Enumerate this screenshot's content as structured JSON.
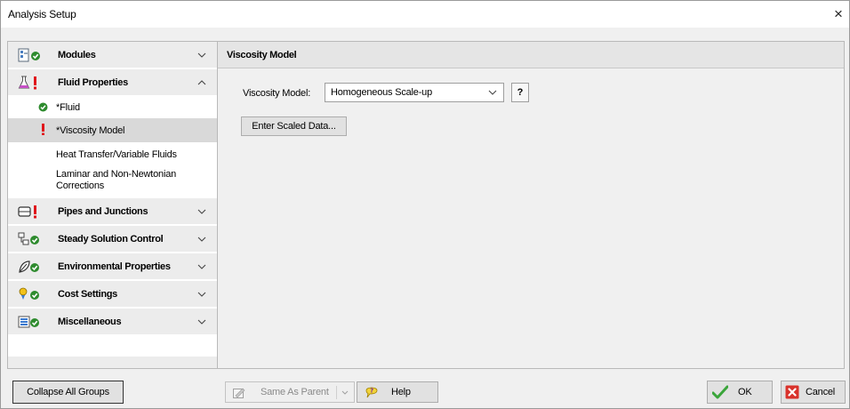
{
  "window": {
    "title": "Analysis Setup",
    "close_glyph": "×"
  },
  "sidebar": {
    "groups": [
      {
        "label": "Modules",
        "icon": "modules-icon",
        "status": "ok",
        "chevron": "down"
      },
      {
        "label": "Fluid Properties",
        "icon": "flask-icon",
        "status": "error",
        "chevron": "up",
        "items": [
          {
            "label": "*Fluid",
            "status": "ok"
          },
          {
            "label": "*Viscosity Model",
            "status": "error",
            "selected": true
          },
          {
            "label": "Heat Transfer/Variable Fluids",
            "status": "none"
          },
          {
            "label": "Laminar and Non-Newtonian Corrections",
            "status": "none"
          }
        ]
      },
      {
        "label": "Pipes and Junctions",
        "icon": "pipe-icon",
        "status": "error",
        "chevron": "down"
      },
      {
        "label": "Steady Solution Control",
        "icon": "solution-control-icon",
        "status": "ok",
        "chevron": "down"
      },
      {
        "label": "Environmental Properties",
        "icon": "environment-icon",
        "status": "ok",
        "chevron": "down"
      },
      {
        "label": "Cost Settings",
        "icon": "cost-icon",
        "status": "ok",
        "chevron": "down"
      },
      {
        "label": "Miscellaneous",
        "icon": "misc-icon",
        "status": "ok",
        "chevron": "down"
      }
    ]
  },
  "content": {
    "header": "Viscosity Model",
    "viscosity_label": "Viscosity Model:",
    "viscosity_value": "Homogeneous Scale-up",
    "help_q": "?",
    "enter_scaled": "Enter Scaled Data..."
  },
  "footer": {
    "collapse": "Collapse All Groups",
    "same_as_parent": "Same As Parent",
    "help": "Help",
    "ok": "OK",
    "cancel": "Cancel"
  },
  "colors": {
    "ok_green": "#2e8b2e",
    "error_red": "#e0151b",
    "cancel_red": "#d9322b"
  }
}
